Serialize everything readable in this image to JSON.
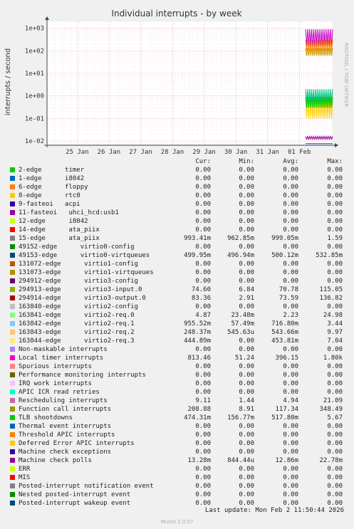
{
  "title": "Individual interrupts - by week",
  "side_label": "RRDTOOL / TOBI OETIKER",
  "footer": "Last update: Mon Feb  2 11:50:44 2026",
  "munin_version": "Munin 2.0.57",
  "colors": {
    "background": "#f0f0f0",
    "plot": "#ffffff",
    "grid_major": "#e8b0b0",
    "grid_minor": "#f0d0d0"
  },
  "legend_header": {
    "cur": "Cur:",
    "min": "Min:",
    "avg": "Avg:",
    "max": "Max:"
  },
  "chart_data": {
    "type": "line",
    "title": "Individual interrupts - by week",
    "ylabel": "interrupts / second",
    "yscale": "log",
    "ylim": [
      0.007,
      2000
    ],
    "y_ticks": [
      0.01,
      0.1,
      1,
      10,
      100,
      1000
    ],
    "y_tick_labels": [
      "1e-02",
      "1e-01",
      "1e+00",
      "1e+01",
      "1e+02",
      "1e+03"
    ],
    "x_tick_labels": [
      "25 Jan",
      "26 Jan",
      "27 Jan",
      "28 Jan",
      "29 Jan",
      "30 Jan",
      "31 Jan",
      "01 Feb"
    ],
    "x_tick_days": [
      1,
      2,
      3,
      4,
      5,
      6,
      7,
      8
    ],
    "x_range_days": [
      0.05,
      9.05
    ],
    "data_start_day": 8.2,
    "grid": true,
    "legend_position": "bottom",
    "series_ranges": [
      {
        "color": "#cc00cc",
        "lo": 150,
        "hi": 900
      },
      {
        "color": "#cc9900",
        "lo": 60,
        "hi": 130
      },
      {
        "color": "#ff8800",
        "lo": 100,
        "hi": 300
      },
      {
        "color": "#ff66cc",
        "lo": 0.4,
        "hi": 1.5
      },
      {
        "color": "#ffcc00",
        "lo": 0.1,
        "hi": 0.8
      },
      {
        "color": "#00cc88",
        "lo": 0.5,
        "hi": 2
      },
      {
        "color": "#00cc00",
        "lo": 0.3,
        "hi": 0.9
      },
      {
        "color": "#990099",
        "lo": 0.012,
        "hi": 0.016
      },
      {
        "color": "#0066b3",
        "lo": 0.0075,
        "hi": 0.0078
      }
    ]
  },
  "legend": [
    {
      "name": "2-edge      timer",
      "color": "#00cc00",
      "cur": "0.00",
      "min": "0.00",
      "avg": "0.00",
      "max": "0.00"
    },
    {
      "name": "1-edge      i8042",
      "color": "#0066b3",
      "cur": "0.00",
      "min": "0.00",
      "avg": "0.00",
      "max": "0.00"
    },
    {
      "name": "6-edge      floppy",
      "color": "#ff8000",
      "cur": "0.00",
      "min": "0.00",
      "avg": "0.00",
      "max": "0.00"
    },
    {
      "name": "8-edge      rtc0",
      "color": "#ffcc00",
      "cur": "0.00",
      "min": "0.00",
      "avg": "0.00",
      "max": "0.00"
    },
    {
      "name": "9-fasteoi   acpi",
      "color": "#330099",
      "cur": "0.00",
      "min": "0.00",
      "avg": "0.00",
      "max": "0.00"
    },
    {
      "name": "11-fasteoi   uhci_hcd:usb1",
      "color": "#990099",
      "cur": "0.00",
      "min": "0.00",
      "avg": "0.00",
      "max": "0.00"
    },
    {
      "name": "12-edge      i8042",
      "color": "#ccff00",
      "cur": "0.00",
      "min": "0.00",
      "avg": "0.00",
      "max": "0.00"
    },
    {
      "name": "14-edge      ata_piix",
      "color": "#ff0000",
      "cur": "0.00",
      "min": "0.00",
      "avg": "0.00",
      "max": "0.00"
    },
    {
      "name": "15-edge      ata_piix",
      "color": "#808080",
      "cur": "993.41m",
      "min": "962.85m",
      "avg": "999.05m",
      "max": "1.59"
    },
    {
      "name": "49152-edge      virtio0-config",
      "color": "#008f00",
      "cur": "0.00",
      "min": "0.00",
      "avg": "0.00",
      "max": "0.00"
    },
    {
      "name": "49153-edge      virtio0-virtqueues",
      "color": "#00487d",
      "cur": "499.95m",
      "min": "496.94m",
      "avg": "500.12m",
      "max": "532.85m"
    },
    {
      "name": "131072-edge      virtio1-config",
      "color": "#b35a00",
      "cur": "0.00",
      "min": "0.00",
      "avg": "0.00",
      "max": "0.00"
    },
    {
      "name": "131073-edge      virtio1-virtqueues",
      "color": "#b38f00",
      "cur": "0.00",
      "min": "0.00",
      "avg": "0.00",
      "max": "0.00"
    },
    {
      "name": "294912-edge      virtio3-config",
      "color": "#6b006b",
      "cur": "0.00",
      "min": "0.00",
      "avg": "0.00",
      "max": "0.00"
    },
    {
      "name": "294913-edge      virtio3-input.0",
      "color": "#8fb300",
      "cur": "74.60",
      "min": "6.84",
      "avg": "70.78",
      "max": "115.05"
    },
    {
      "name": "294914-edge      virtio3-output.0",
      "color": "#b30000",
      "cur": "83.36",
      "min": "2.91",
      "avg": "73.59",
      "max": "136.82"
    },
    {
      "name": "163840-edge      virtio2-config",
      "color": "#bebebe",
      "cur": "0.00",
      "min": "0.00",
      "avg": "0.00",
      "max": "0.00"
    },
    {
      "name": "163841-edge      virtio2-req.0",
      "color": "#80ff80",
      "cur": "4.87",
      "min": "23.48m",
      "avg": "2.23",
      "max": "24.98"
    },
    {
      "name": "163842-edge      virtio2-req.1",
      "color": "#80c9ff",
      "cur": "955.52m",
      "min": "57.49m",
      "avg": "716.80m",
      "max": "3.44"
    },
    {
      "name": "163843-edge      virtio2-req.2",
      "color": "#ffc080",
      "cur": "248.37m",
      "min": "545.63u",
      "avg": "543.66m",
      "max": "9.97"
    },
    {
      "name": "163844-edge      virtio2-req.3",
      "color": "#ffe680",
      "cur": "444.89m",
      "min": "0.00",
      "avg": "453.81m",
      "max": "7.04"
    },
    {
      "name": "Non-maskable interrupts",
      "color": "#aa80ff",
      "cur": "0.00",
      "min": "0.00",
      "avg": "0.00",
      "max": "0.00"
    },
    {
      "name": "Local timer interrupts",
      "color": "#ee00cc",
      "cur": "813.46",
      "min": "51.24",
      "avg": "396.15",
      "max": "1.80k"
    },
    {
      "name": "Spurious interrupts",
      "color": "#ff8080",
      "cur": "0.00",
      "min": "0.00",
      "avg": "0.00",
      "max": "0.00"
    },
    {
      "name": "Performance monitoring interrupts",
      "color": "#666600",
      "cur": "0.00",
      "min": "0.00",
      "avg": "0.00",
      "max": "0.00"
    },
    {
      "name": "IRQ work interrupts",
      "color": "#ffbfff",
      "cur": "0.00",
      "min": "0.00",
      "avg": "0.00",
      "max": "0.00"
    },
    {
      "name": "APIC ICR read retries",
      "color": "#00ffcc",
      "cur": "0.00",
      "min": "0.00",
      "avg": "0.00",
      "max": "0.00"
    },
    {
      "name": "Rescheduling interrupts",
      "color": "#cc6699",
      "cur": "9.11",
      "min": "1.44",
      "avg": "4.94",
      "max": "21.09"
    },
    {
      "name": "Function call interrupts",
      "color": "#999900",
      "cur": "208.88",
      "min": "8.91",
      "avg": "117.34",
      "max": "348.49"
    },
    {
      "name": "TLB shootdowns",
      "color": "#00cc00",
      "cur": "474.31m",
      "min": "156.77m",
      "avg": "517.80m",
      "max": "5.67"
    },
    {
      "name": "Thermal event interrupts",
      "color": "#0066b3",
      "cur": "0.00",
      "min": "0.00",
      "avg": "0.00",
      "max": "0.00"
    },
    {
      "name": "Threshold APIC interrupts",
      "color": "#ff8000",
      "cur": "0.00",
      "min": "0.00",
      "avg": "0.00",
      "max": "0.00"
    },
    {
      "name": "Deferred Error APIC interrupts",
      "color": "#ffcc00",
      "cur": "0.00",
      "min": "0.00",
      "avg": "0.00",
      "max": "0.00"
    },
    {
      "name": "Machine check exceptions",
      "color": "#330099",
      "cur": "0.00",
      "min": "0.00",
      "avg": "0.00",
      "max": "0.00"
    },
    {
      "name": "Machine check polls",
      "color": "#990099",
      "cur": "13.28m",
      "min": "844.44u",
      "avg": "12.86m",
      "max": "22.78m"
    },
    {
      "name": "ERR",
      "color": "#ccff00",
      "cur": "0.00",
      "min": "0.00",
      "avg": "0.00",
      "max": "0.00"
    },
    {
      "name": "MIS",
      "color": "#ff0000",
      "cur": "0.00",
      "min": "0.00",
      "avg": "0.00",
      "max": "0.00"
    },
    {
      "name": "Posted-interrupt notification event",
      "color": "#808080",
      "cur": "0.00",
      "min": "0.00",
      "avg": "0.00",
      "max": "0.00"
    },
    {
      "name": "Nested posted-interrupt event",
      "color": "#008f00",
      "cur": "0.00",
      "min": "0.00",
      "avg": "0.00",
      "max": "0.00"
    },
    {
      "name": "Posted-interrupt wakeup event",
      "color": "#00487d",
      "cur": "0.00",
      "min": "0.00",
      "avg": "0.00",
      "max": "0.00"
    }
  ]
}
